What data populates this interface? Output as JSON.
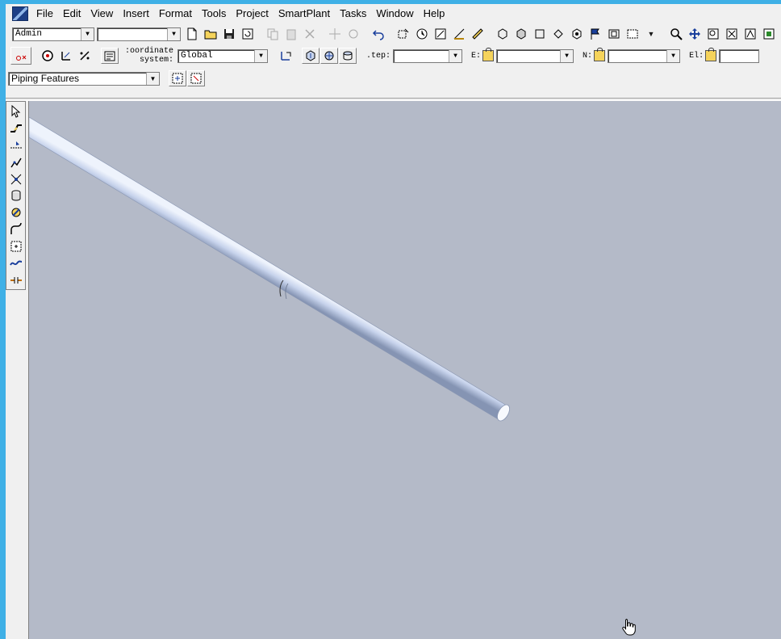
{
  "menu": {
    "items": [
      "File",
      "Edit",
      "View",
      "Insert",
      "Format",
      "Tools",
      "Project",
      "SmartPlant",
      "Tasks",
      "Window",
      "Help"
    ]
  },
  "toolbar1": {
    "user_combo": "Admin",
    "second_combo": ""
  },
  "toolbar2": {
    "coordinate_label": "Coordinate system:",
    "coordinate_label_line1": ":oordinate",
    "coordinate_label_line2": "system:",
    "coordinate_value": "Global",
    "step_label": ".tep:",
    "step_value": "",
    "e_label": "E:",
    "e_value": "",
    "n_label": "N:",
    "n_value": "",
    "el_label": "El:",
    "el_value": ""
  },
  "toolbar3": {
    "features_combo": "Piping Features"
  },
  "colors": {
    "viewport_bg": "#b4bac8",
    "pipe": "#c8d4ec",
    "window_frame": "#3fb0e6"
  }
}
